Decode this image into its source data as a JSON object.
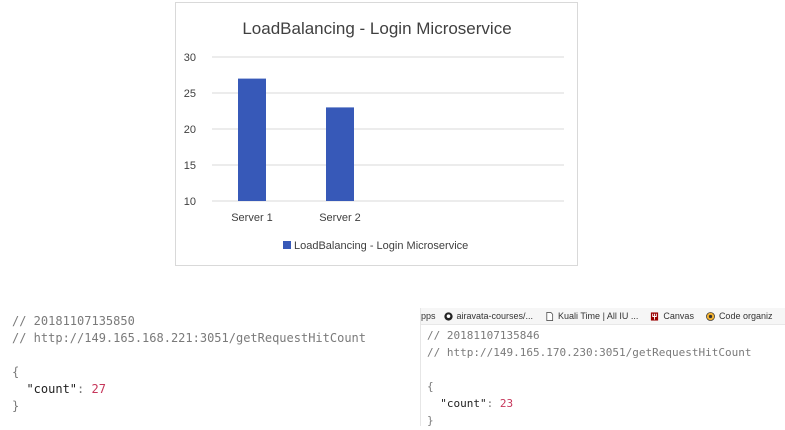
{
  "chart_data": {
    "type": "bar",
    "title": "LoadBalancing - Login Microservice",
    "categories": [
      "Server 1",
      "Server 2"
    ],
    "series": [
      {
        "name": "LoadBalancing - Login Microservice",
        "values": [
          27,
          23
        ]
      }
    ],
    "ylim": [
      10,
      30
    ],
    "yticks": [
      10,
      15,
      20,
      25,
      30
    ],
    "grid": true,
    "legend_position": "bottom",
    "bar_color": "#3759b8"
  },
  "left_response": {
    "comment_timestamp": "// 20181107135850",
    "comment_url": "// http://149.165.168.221:3051/getRequestHitCount",
    "open_brace": "{",
    "key": "\"count\"",
    "colon": ": ",
    "value": "27",
    "close_brace": "}"
  },
  "right_response": {
    "bookmarks": [
      {
        "label": "pps",
        "icon": "apps-icon"
      },
      {
        "label": "airavata-courses/...",
        "icon": "github-icon"
      },
      {
        "label": "Kuali Time | All IU ...",
        "icon": "page-icon"
      },
      {
        "label": "Canvas",
        "icon": "iu-trident-icon"
      },
      {
        "label": "Code organiz",
        "icon": "circle-icon"
      }
    ],
    "comment_timestamp": "// 20181107135846",
    "comment_url": "// http://149.165.170.230:3051/getRequestHitCount",
    "open_brace": "{",
    "key": "\"count\"",
    "colon": ": ",
    "value": "23",
    "close_brace": "}"
  }
}
